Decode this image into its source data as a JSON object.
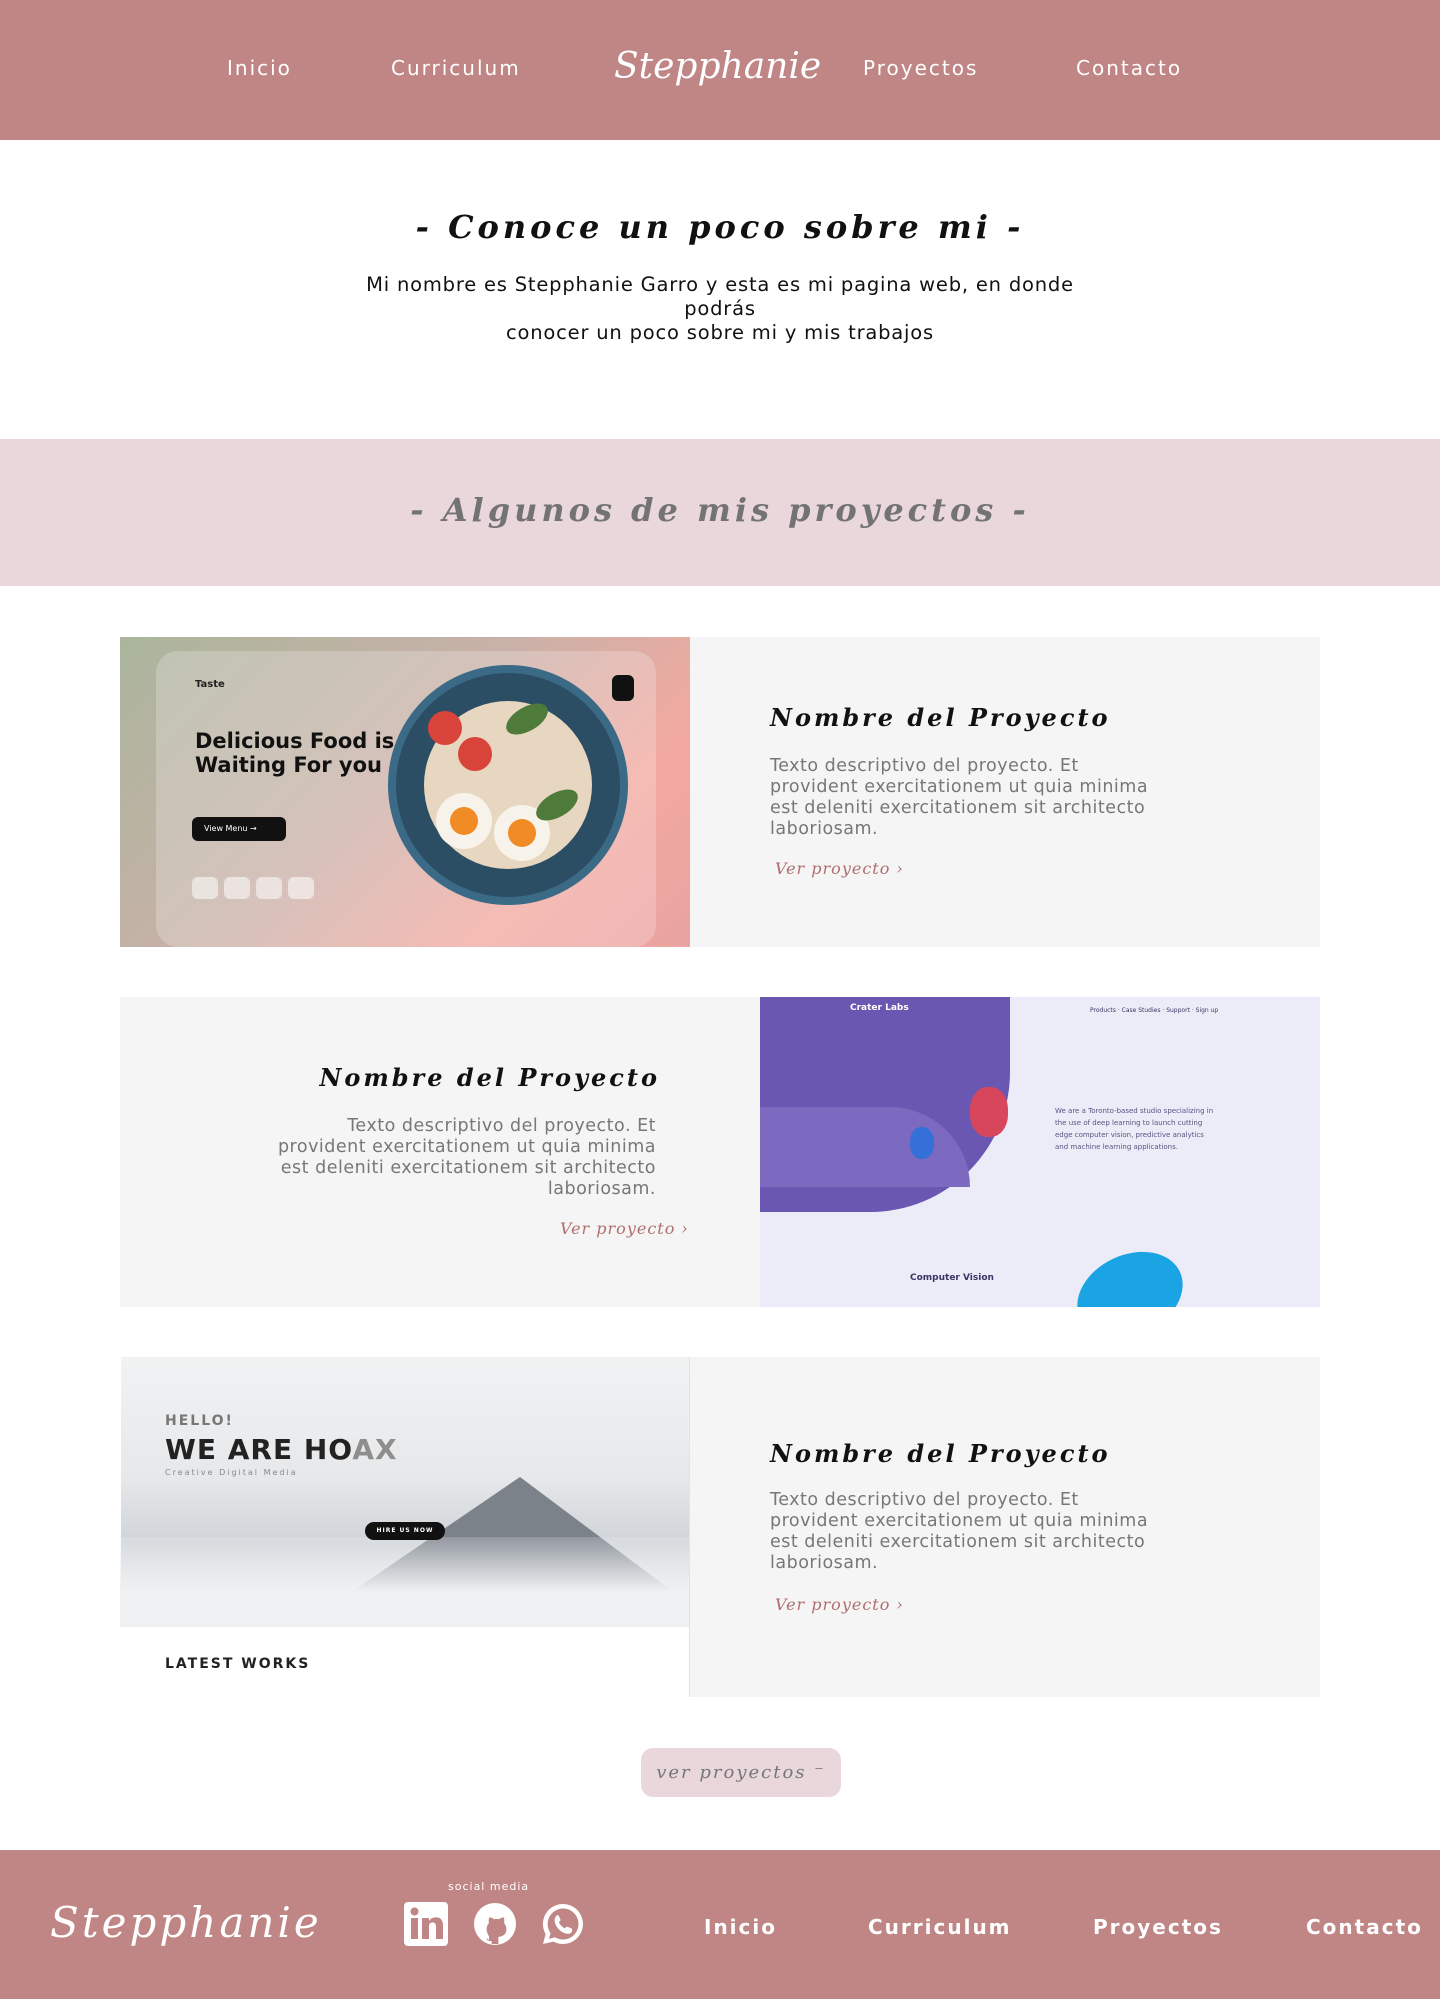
{
  "header": {
    "nav_left": [
      "Inicio",
      "Curriculum"
    ],
    "brand": "Stepphanie",
    "nav_right": [
      "Proyectos",
      "Contacto"
    ]
  },
  "about": {
    "title": "- Conoce un poco sobre mi -",
    "text_line1": "Mi nombre es Stepphanie Garro y esta es mi pagina web, en donde podrás",
    "text_line2": "conocer un poco sobre mi y mis trabajos"
  },
  "projects_banner": {
    "title": "- Algunos de mis proyectos -"
  },
  "projects": [
    {
      "title": "Nombre del Proyecto",
      "description": "Texto descriptivo del proyecto. Et provident exercitationem ut quia minima est deleniti exercitationem sit architecto laboriosam.",
      "link": "Ver proyecto ›",
      "preview": {
        "brand": "Taste",
        "headline": "Delicious Food is Waiting For you",
        "button": "View Menu  →"
      }
    },
    {
      "title": "Nombre del Proyecto",
      "description": "Texto descriptivo del proyecto. Et provident exercitationem ut quia minima est deleniti exercitationem sit architecto laboriosam.",
      "link": "Ver proyecto ›",
      "preview": {
        "brand": "Crater Labs",
        "nav": "Products ·  Case Studies ·  Support ·  Sign up",
        "copy": "We are a Toronto-based studio specializing in the use of deep learning to launch cutting edge computer vision, predictive analytics and machine learning applications.",
        "section": "Computer Vision"
      }
    },
    {
      "title": "Nombre del Proyecto",
      "description": "Texto descriptivo del proyecto. Et provident exercitationem ut quia minima est deleniti exercitationem sit architecto laboriosam.",
      "link": "Ver proyecto ›",
      "preview": {
        "hello": "HELLO!",
        "headline_main": "WE ARE HO",
        "headline_faded": "AX",
        "subtitle": "Creative Digital Media",
        "button": "HIRE US NOW",
        "section": "LATEST WORKS"
      }
    }
  ],
  "more_button": {
    "label": "ver proyectos ⁻"
  },
  "footer": {
    "brand": "Stepphanie",
    "social_label": "social media",
    "social_icons": [
      "linkedin-icon",
      "github-icon",
      "whatsapp-icon"
    ],
    "links": [
      "Inicio",
      "Curriculum",
      "Proyectos",
      "Contacto"
    ]
  },
  "colors": {
    "primary": "#c08585",
    "banner": "#e9d7dc",
    "card_bg": "#f5f5f5",
    "link": "#b06e6e",
    "muted_text": "#777777"
  }
}
